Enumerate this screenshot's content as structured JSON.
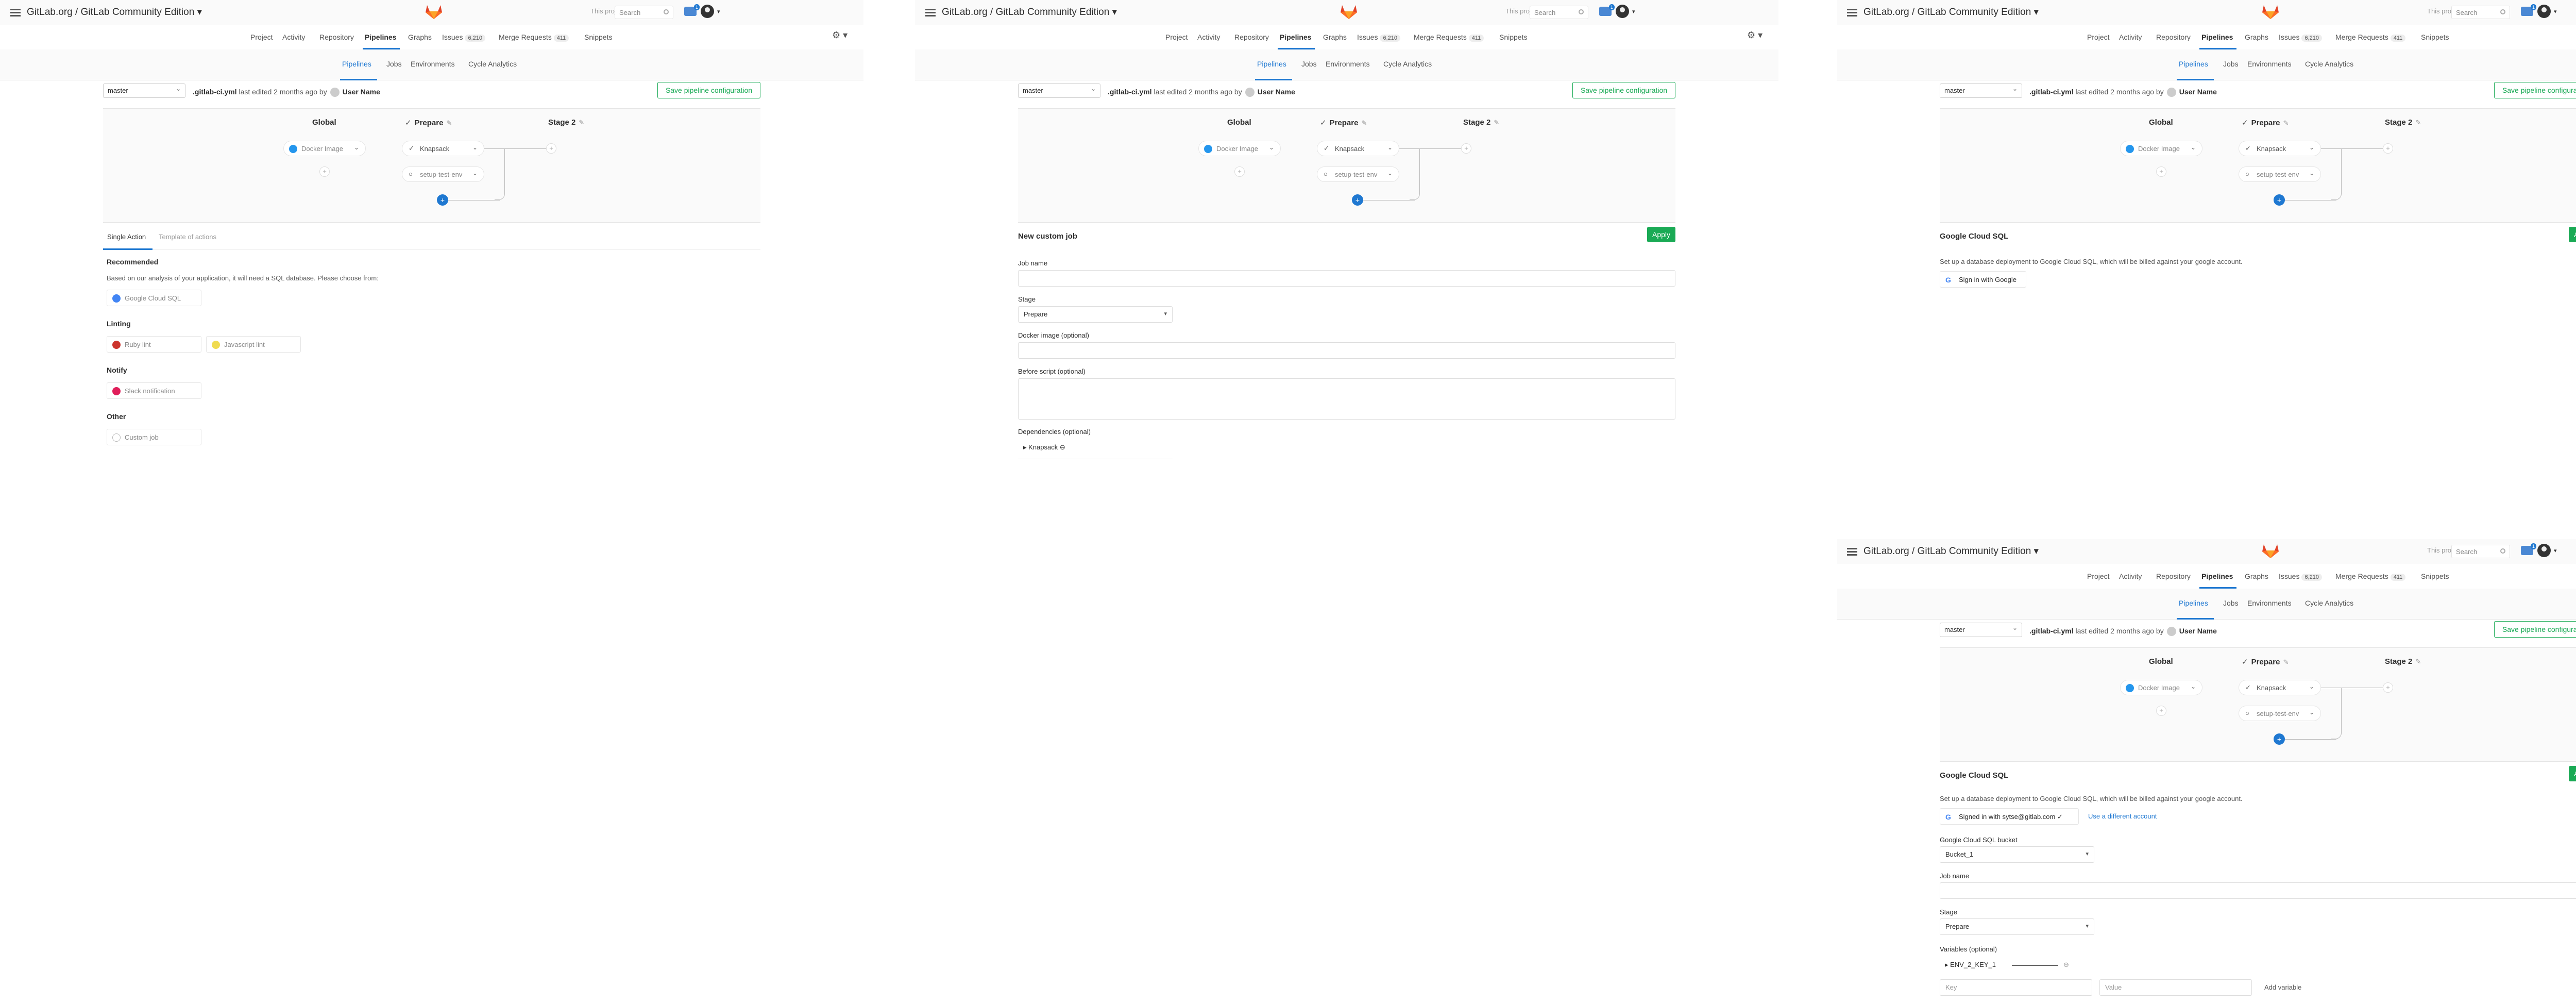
{
  "app": {
    "title": "GitLab.org / GitLab Community Edition ▾",
    "scope": "This project",
    "search_placeholder": "Search",
    "todo_count": "1",
    "caret": "▾",
    "gear": "⚙ ▾"
  },
  "nav": {
    "project": "Project",
    "activity": "Activity",
    "repository": "Repository",
    "pipelines": "Pipelines",
    "graphs": "Graphs",
    "issues": "Issues",
    "issues_count": "6,210",
    "merge_requests": "Merge Requests",
    "mr_count": "411",
    "snippets": "Snippets"
  },
  "subnav": {
    "pipelines": "Pipelines",
    "jobs": "Jobs",
    "environments": "Environments",
    "cycle": "Cycle Analytics"
  },
  "editor": {
    "branch": "master",
    "file": ".gitlab-ci.yml",
    "edited": "last edited 2 months ago by",
    "user": "User Name",
    "save": "Save pipeline configuration",
    "stage_global": "Global",
    "stage_prepare": "Prepare",
    "stage_2": "Stage 2",
    "check": "✓",
    "pencil": "✎",
    "plus": "+",
    "job_docker": "Docker Image",
    "job_knapsack": "Knapsack",
    "job_setup": "setup-test-env"
  },
  "actions": {
    "tab_single": "Single Action",
    "tab_template": "Template of actions",
    "recommended": "Recommended",
    "analysis": "Based on our analysis of your application, it will need a SQL database. Please choose from:",
    "gcloud": "Google Cloud SQL",
    "linting": "Linting",
    "ruby": "Ruby lint",
    "js": "Javascript lint",
    "notify": "Notify",
    "slack": "Slack notification",
    "other": "Other",
    "custom": "Custom job"
  },
  "custom_job": {
    "title": "New custom job",
    "apply": "Apply",
    "job_name": "Job name",
    "stage": "Stage",
    "stage_value": "Prepare",
    "docker": "Docker image (optional)",
    "before": "Before script (optional)",
    "deps": "Dependencies (optional)",
    "dep_item": "▸  Knapsack  ⊖"
  },
  "gcsql": {
    "title": "Google Cloud SQL",
    "apply": "Apply",
    "desc": "Set up a database deployment to Google Cloud SQL, which will be billed against your google account.",
    "signin": "Sign in with Google",
    "signed_in": "Signed in with sytse@gitlab.com",
    "signed_check": "✓",
    "other_account": "Use a different account",
    "bucket_label": "Google Cloud SQL bucket",
    "bucket": "Bucket_1",
    "job_name": "Job name",
    "stage": "Stage",
    "stage_value": "Prepare",
    "vars": "Variables (optional)",
    "var_name": "▸  ENV_2_KEY_1",
    "var_remove": "⊖",
    "key_ph": "Key",
    "value_ph": "Value",
    "add_var": "Add variable"
  },
  "colors": {
    "accent": "#1f78d1",
    "green": "#1aaa55",
    "brand": "#fc6d26"
  }
}
